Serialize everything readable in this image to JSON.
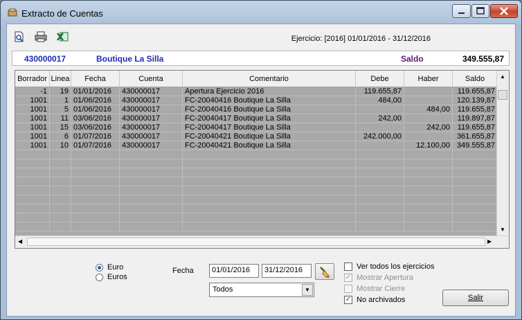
{
  "window": {
    "title": "Extracto de Cuentas"
  },
  "toolbar": {
    "ejercicio": "Ejercicio: [2016] 01/01/2016 - 31/12/2016"
  },
  "account": {
    "code": "430000017",
    "name": "Boutique La Silla",
    "saldo_label": "Saldo",
    "saldo_value": "349.555,87"
  },
  "grid": {
    "columns": [
      "Borrador",
      "Linea",
      "Fecha",
      "Cuenta",
      "Comentario",
      "Debe",
      "Haber",
      "Saldo"
    ],
    "rows": [
      {
        "borrador": "-1",
        "linea": "19",
        "fecha": "01/01/2016",
        "cuenta": "430000017",
        "comentario": "Apertura Ejercicio 2016",
        "debe": "119.655,87",
        "haber": "",
        "saldo": "119.655,87"
      },
      {
        "borrador": "1001",
        "linea": "1",
        "fecha": "01/06/2016",
        "cuenta": "430000017",
        "comentario": "FC-20040416 Boutique La Silla",
        "debe": "484,00",
        "haber": "",
        "saldo": "120.139,87"
      },
      {
        "borrador": "1001",
        "linea": "5",
        "fecha": "01/06/2016",
        "cuenta": "430000017",
        "comentario": "FC-20040416 Boutique La Silla",
        "debe": "",
        "haber": "484,00",
        "saldo": "119.655,87"
      },
      {
        "borrador": "1001",
        "linea": "11",
        "fecha": "03/06/2016",
        "cuenta": "430000017",
        "comentario": "FC-20040417 Boutique La Silla",
        "debe": "242,00",
        "haber": "",
        "saldo": "119.897,87"
      },
      {
        "borrador": "1001",
        "linea": "15",
        "fecha": "03/06/2016",
        "cuenta": "430000017",
        "comentario": "FC-20040417 Boutique La Silla",
        "debe": "",
        "haber": "242,00",
        "saldo": "119.655,87"
      },
      {
        "borrador": "1001",
        "linea": "6",
        "fecha": "01/07/2016",
        "cuenta": "430000017",
        "comentario": "FC-20040421 Boutique La Silla",
        "debe": "242.000,00",
        "haber": "",
        "saldo": "361.655,87"
      },
      {
        "borrador": "1001",
        "linea": "10",
        "fecha": "01/07/2016",
        "cuenta": "430000017",
        "comentario": "FC-20040421 Boutique La Silla",
        "debe": "",
        "haber": "12.100,00",
        "saldo": "349.555,87"
      }
    ]
  },
  "currency": {
    "option1": "Euro",
    "option2": "Euros",
    "selected": "Euro"
  },
  "filter": {
    "fecha_label": "Fecha",
    "date_from": "01/01/2016",
    "date_to": "31/12/2016",
    "combo_value": "Todos"
  },
  "options": {
    "ver_todos": {
      "label": "Ver todos los ejercicios",
      "checked": false,
      "enabled": true
    },
    "mostrar_apertura": {
      "label": "Mostrar Apertura",
      "checked": true,
      "enabled": false
    },
    "mostrar_cierre": {
      "label": "Mostrar Cierre",
      "checked": false,
      "enabled": false
    },
    "no_archivados": {
      "label": "No archivados",
      "checked": true,
      "enabled": true
    }
  },
  "buttons": {
    "salir": "Salir"
  },
  "icons": [
    "window-app-icon",
    "print-preview-icon",
    "print-icon",
    "excel-export-icon",
    "brush-icon"
  ]
}
